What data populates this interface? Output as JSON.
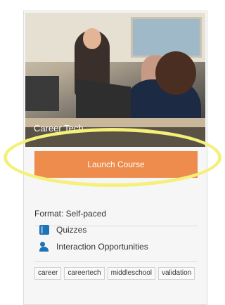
{
  "course": {
    "title": "Career Tech",
    "launch_label": "Launch Course",
    "format_label": "Format: Self-paced",
    "features": [
      {
        "icon": "book-icon",
        "label": "Quizzes"
      },
      {
        "icon": "people-icon",
        "label": "Interaction Opportunities"
      }
    ],
    "tags": [
      "career",
      "careertech",
      "middleschool",
      "validation"
    ]
  },
  "colors": {
    "button": "#ed8c4c",
    "highlight": "#f4f07a",
    "icon": "#1f73b7"
  }
}
